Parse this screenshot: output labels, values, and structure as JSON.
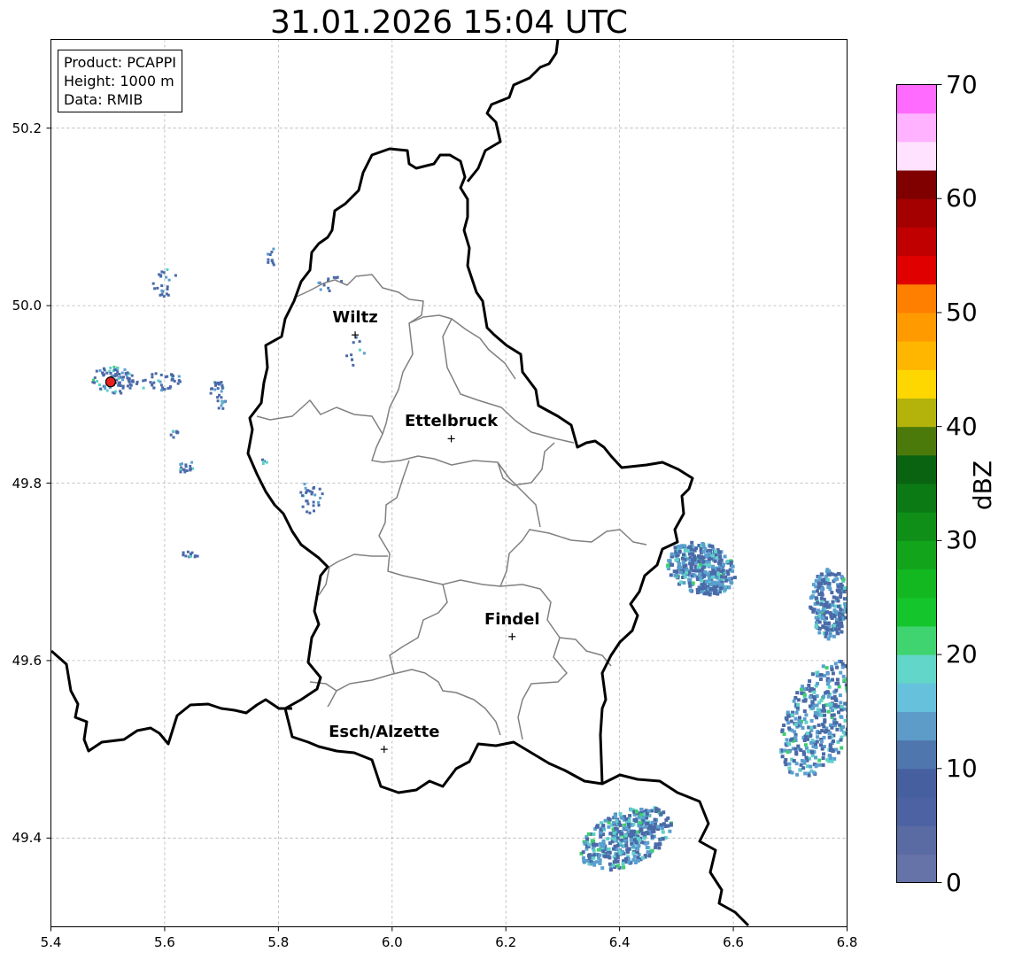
{
  "title": "31.01.2026 15:04 UTC",
  "info_box": {
    "product": "Product: PCAPPI",
    "height": "Height: 1000 m",
    "data": "Data: RMIB"
  },
  "axes": {
    "x_ticks": [
      "5.4",
      "5.6",
      "5.8",
      "6.0",
      "6.2",
      "6.4",
      "6.6",
      "6.8"
    ],
    "y_ticks": [
      "50.2",
      "50.0",
      "49.8",
      "49.6",
      "49.4"
    ],
    "x_range": [
      5.4,
      6.8
    ],
    "y_range": [
      49.3,
      50.3
    ],
    "grid": true
  },
  "cities": [
    {
      "name": "Wiltz",
      "lon": 5.935,
      "lat": 49.967
    },
    {
      "name": "Ettelbruck",
      "lon": 6.104,
      "lat": 49.85
    },
    {
      "name": "Findel",
      "lon": 6.211,
      "lat": 49.627
    },
    {
      "name": "Esch/Alzette",
      "lon": 5.986,
      "lat": 49.5
    }
  ],
  "radar_site": {
    "lon": 5.505,
    "lat": 49.914,
    "color": "#e8201c"
  },
  "colorbar": {
    "label": "dBZ",
    "tick_labels": [
      "0",
      "10",
      "20",
      "30",
      "40",
      "50",
      "60",
      "70"
    ],
    "min": 0,
    "max": 70,
    "step": 2.5,
    "colors": [
      "#6673a8",
      "#5a6aa3",
      "#4c62a2",
      "#455f9f",
      "#4f76ad",
      "#5d9bc8",
      "#66c1dd",
      "#62d6c8",
      "#3fd46f",
      "#14c62b",
      "#13b821",
      "#12a51c",
      "#0f8f18",
      "#0c7a14",
      "#096311",
      "#4b7a0b",
      "#b3b30b",
      "#ffd700",
      "#ffb600",
      "#ff9a00",
      "#ff7f00",
      "#e00000",
      "#c00000",
      "#a40000",
      "#800000",
      "#ffe2ff",
      "#ffb2ff",
      "#ff6bff",
      "#ee38ee"
    ]
  },
  "echo_colors": {
    "low": "#4a6aa8",
    "mid": "#5aa0cf",
    "high": "#5fd0c8",
    "peak": "#3fcf6e"
  }
}
